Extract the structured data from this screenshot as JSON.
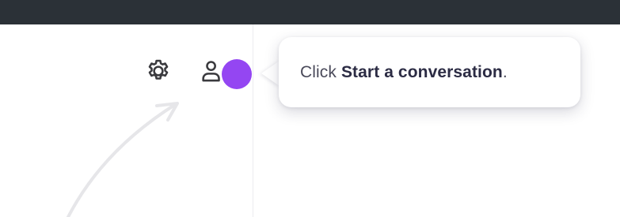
{
  "toolbar": {
    "settings_icon": "gear-icon",
    "profile_icon": "user-icon"
  },
  "tooltip": {
    "prefix": "Click ",
    "action": "Start a conversation",
    "suffix": "."
  },
  "colors": {
    "top_bar": "#2b3137",
    "highlight": "#9446f2",
    "icon": "#3a3a3e",
    "annotation_arrow": "#e6e6e9"
  }
}
